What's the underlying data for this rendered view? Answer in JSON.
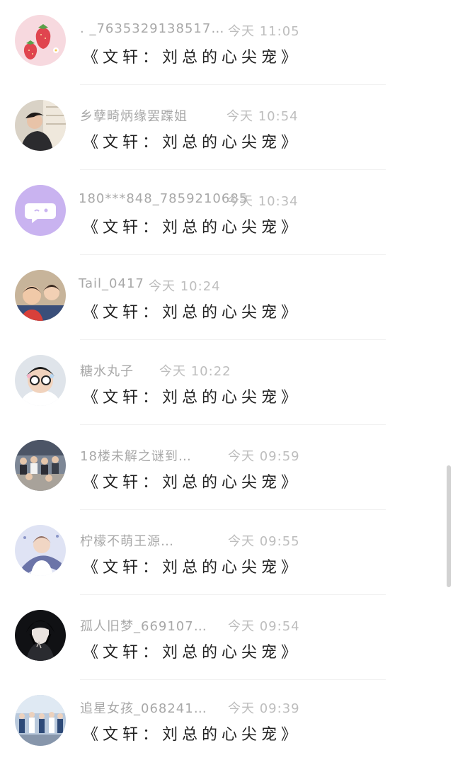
{
  "messages": [
    {
      "name": ". _7635329138517…",
      "time": "今天 11:05",
      "text": "《文轩：刘总的心尖宠》",
      "avatar": "strawberry-avatar"
    },
    {
      "name": "乡孽畸炳缘罢蹀姐",
      "time": "今天 10:54",
      "text": "《文轩：刘总的心尖宠》",
      "avatar": "boy-photo-avatar"
    },
    {
      "name": "180***848_7859210685",
      "time": "今天 10:34",
      "text": "《文轩：刘总的心尖宠》",
      "avatar": "default-chat-avatar"
    },
    {
      "name": "Tail_0417",
      "time": "今天 10:24",
      "text": "《文轩：刘总的心尖宠》",
      "avatar": "two-kids-photo-avatar"
    },
    {
      "name": "糖水丸子",
      "time": "今天 10:22",
      "text": "《文轩：刘总的心尖宠》",
      "avatar": "glasses-boy-avatar"
    },
    {
      "name": "18楼未解之谜到…",
      "time": "今天 09:59",
      "text": "《文轩：刘总的心尖宠》",
      "avatar": "group-photo-avatar"
    },
    {
      "name": "柠檬不萌王源…",
      "time": "今天 09:55",
      "text": "《文轩：刘总的心尖宠》",
      "avatar": "idol-fan-avatar"
    },
    {
      "name": "孤人旧梦_669107…",
      "time": "今天 09:54",
      "text": "《文轩：刘总的心尖宠》",
      "avatar": "anime-boy-avatar"
    },
    {
      "name": "追星女孩_068241…",
      "time": "今天 09:39",
      "text": "《文轩：刘总的心尖宠》",
      "avatar": "stage-group-avatar"
    }
  ],
  "colors": {
    "name_text": "#a8a8a8",
    "time_text": "#bdbdbd",
    "message_text": "#222222",
    "default_avatar_bg": "#c9b3f0"
  }
}
